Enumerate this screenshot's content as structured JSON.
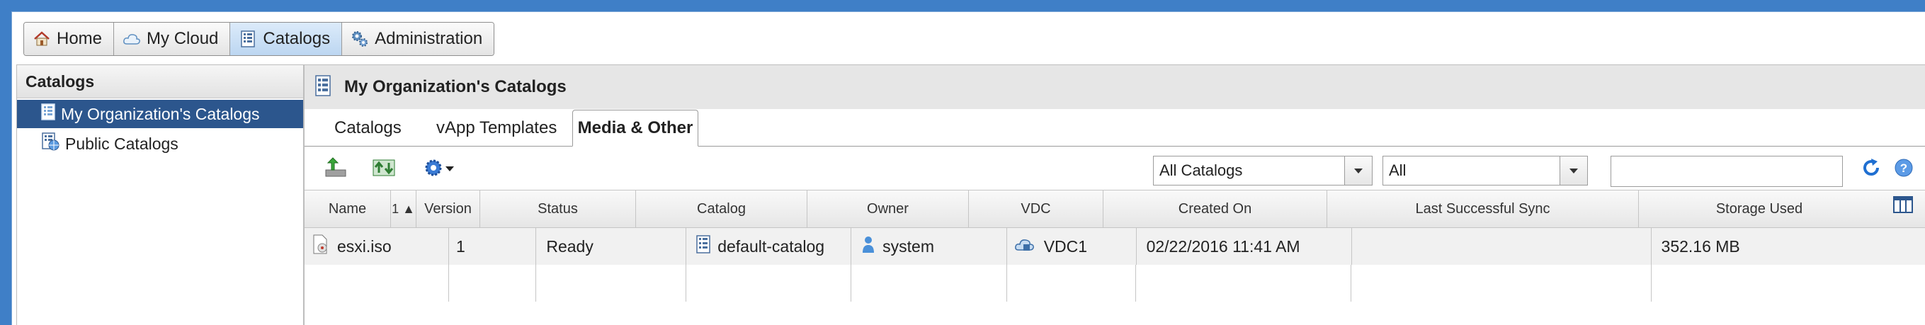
{
  "nav": {
    "items": [
      {
        "label": "Home",
        "icon": "home-icon"
      },
      {
        "label": "My Cloud",
        "icon": "cloud-icon"
      },
      {
        "label": "Catalogs",
        "icon": "catalog-icon"
      },
      {
        "label": "Administration",
        "icon": "admin-gears-icon"
      }
    ],
    "active": "Catalogs"
  },
  "sidebar": {
    "title": "Catalogs",
    "items": [
      {
        "label": "My Organization's Catalogs",
        "icon": "org-catalog-icon",
        "selected": true
      },
      {
        "label": "Public Catalogs",
        "icon": "public-catalog-icon",
        "selected": false
      }
    ]
  },
  "main": {
    "title": "My Organization's Catalogs",
    "tabs": [
      "Catalogs",
      "vApp Templates",
      "Media & Other"
    ],
    "active_tab": "Media & Other",
    "toolbar": {
      "catalog_filter": "All Catalogs",
      "type_filter": "All",
      "search_value": ""
    },
    "table": {
      "sort_indicator": "1 ▲",
      "columns": [
        "Name",
        "Version",
        "Status",
        "Catalog",
        "Owner",
        "VDC",
        "Created On",
        "Last Successful Sync",
        "Storage Used"
      ],
      "rows": [
        {
          "name": "esxi.iso",
          "version": "1",
          "status": "Ready",
          "catalog": "default-catalog",
          "owner": "system",
          "vdc": "VDC1",
          "created_on": "02/22/2016 11:41 AM",
          "last_sync": "",
          "storage_used": "352.16 MB"
        }
      ]
    }
  },
  "colors": {
    "accent_blue": "#2c568d",
    "outer_blue": "#3f7fc7",
    "header_gray": "#e6e6e6"
  }
}
